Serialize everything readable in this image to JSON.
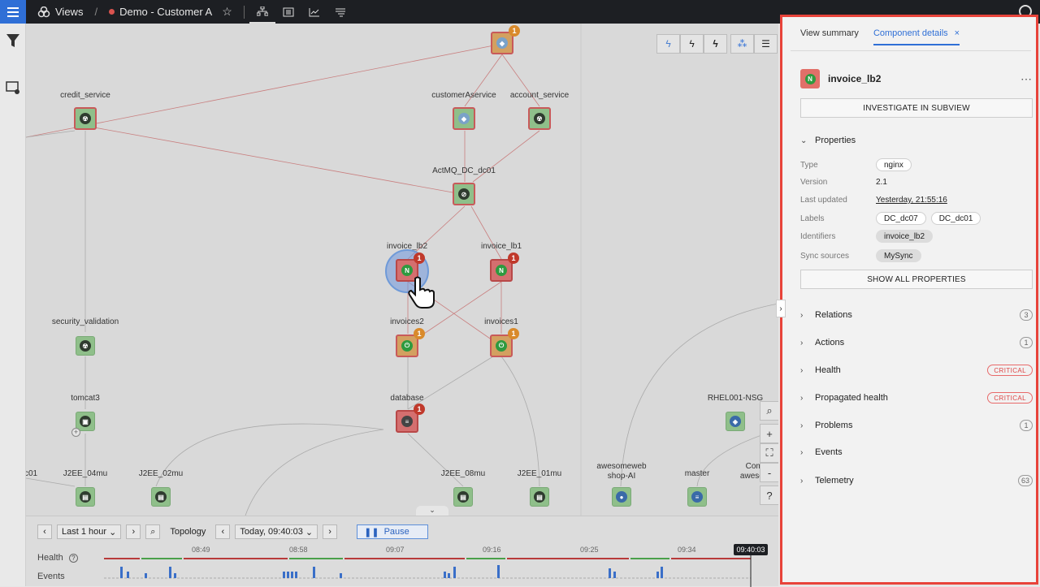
{
  "topbar": {
    "views_label": "Views",
    "view_name": "Demo - Customer A"
  },
  "canvas": {
    "nodes": [
      {
        "id": "top",
        "label": "",
        "color": "orange",
        "badge": "1",
        "badge_color": "orange"
      },
      {
        "id": "credit_service",
        "label": "credit_service",
        "color": "green"
      },
      {
        "id": "customerAservice",
        "label": "customerAservice",
        "color": "green"
      },
      {
        "id": "account_service",
        "label": "account_service",
        "color": "green"
      },
      {
        "id": "ActMQ_DC_dc01",
        "label": "ActMQ_DC_dc01",
        "color": "green"
      },
      {
        "id": "invoice_lb2",
        "label": "invoice_lb2",
        "color": "red",
        "badge": "1",
        "badge_color": "red"
      },
      {
        "id": "invoice_lb1",
        "label": "invoice_lb1",
        "color": "red",
        "badge": "1",
        "badge_color": "red"
      },
      {
        "id": "security_validation",
        "label": "security_validation",
        "color": "green"
      },
      {
        "id": "invoices2",
        "label": "invoices2",
        "color": "orange",
        "badge": "1",
        "badge_color": "orange"
      },
      {
        "id": "invoices1",
        "label": "invoices1",
        "color": "orange",
        "badge": "1",
        "badge_color": "orange"
      },
      {
        "id": "tomcat3",
        "label": "tomcat3",
        "color": "green"
      },
      {
        "id": "database",
        "label": "database",
        "color": "red",
        "badge": "1",
        "badge_color": "red"
      },
      {
        "id": "RHEL001-NSG",
        "label": "RHEL001-NSG",
        "color": "green"
      },
      {
        "id": "c01",
        "label": "c01"
      },
      {
        "id": "J2EE_04mu",
        "label": "J2EE_04mu",
        "color": "green"
      },
      {
        "id": "J2EE_02mu",
        "label": "J2EE_02mu",
        "color": "green"
      },
      {
        "id": "J2EE_08mu",
        "label": "J2EE_08mu",
        "color": "green"
      },
      {
        "id": "J2EE_01mu",
        "label": "J2EE_01mu",
        "color": "green"
      },
      {
        "id": "awesomeweb",
        "label": "awesomeweb\nshop-AI",
        "color": "green"
      },
      {
        "id": "master",
        "label": "master",
        "color": "green"
      },
      {
        "id": "comp_a",
        "label": "Compute_A\nawesomewebs",
        "color": "green"
      }
    ]
  },
  "timeline": {
    "range_label": "Last 1 hour",
    "mode_label": "Topology",
    "time_label": "Today, 09:40:03",
    "pause_label": "Pause",
    "health_label": "Health",
    "events_label": "Events",
    "ticks": [
      "08:49",
      "08:58",
      "09:07",
      "09:16",
      "09:25",
      "09:34"
    ],
    "cursor_time": "09:40:03"
  },
  "panel": {
    "tabs": [
      "View summary",
      "Component details"
    ],
    "component_name": "invoice_lb2",
    "investigate_label": "INVESTIGATE IN SUBVIEW",
    "properties_title": "Properties",
    "properties": {
      "type_key": "Type",
      "type_val": "nginx",
      "version_key": "Version",
      "version_val": "2.1",
      "updated_key": "Last updated",
      "updated_val": "Yesterday, 21:55:16",
      "labels_key": "Labels",
      "labels": [
        "DC_dc07",
        "DC_dc01"
      ],
      "identifiers_key": "Identifiers",
      "identifiers_val": "invoice_lb2",
      "sync_key": "Sync sources",
      "sync_val": "MySync"
    },
    "show_all_label": "SHOW ALL PROPERTIES",
    "sections": {
      "relations": {
        "title": "Relations",
        "count": "3"
      },
      "actions": {
        "title": "Actions",
        "count": "1"
      },
      "health": {
        "title": "Health",
        "status": "CRITICAL"
      },
      "propagated": {
        "title": "Propagated health",
        "status": "CRITICAL"
      },
      "problems": {
        "title": "Problems",
        "count": "1"
      },
      "events": {
        "title": "Events"
      },
      "telemetry": {
        "title": "Telemetry",
        "count": "63"
      }
    },
    "critical_color": "#e8433a"
  }
}
